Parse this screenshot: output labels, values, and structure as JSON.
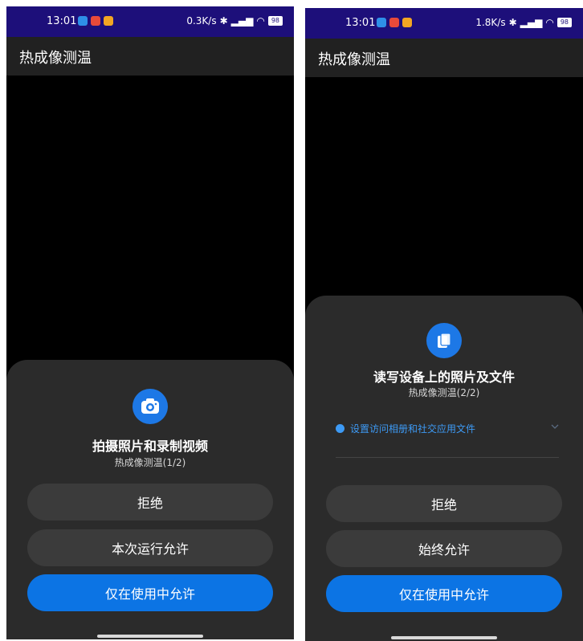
{
  "left": {
    "status": {
      "time": "13:01",
      "network": "0.3K/s",
      "battery": "98"
    },
    "app_title": "热成像测温",
    "dialog": {
      "icon": "camera-icon",
      "title": "拍摄照片和录制视频",
      "subtitle": "热成像测温(1/2)",
      "buttons": {
        "deny": "拒绝",
        "once": "本次运行允许",
        "while_using": "仅在使用中允许"
      }
    }
  },
  "right": {
    "status": {
      "time": "13:01",
      "network": "1.8K/s",
      "battery": "98"
    },
    "app_title": "热成像测温",
    "dialog": {
      "icon": "files-icon",
      "title": "读写设备上的照片及文件",
      "subtitle": "热成像测温(2/2)",
      "link": "设置访问相册和社交应用文件",
      "buttons": {
        "deny": "拒绝",
        "always": "始终允许",
        "while_using": "仅在使用中允许"
      }
    }
  },
  "colors": {
    "status_bar": "#1d0f7a",
    "app_bar": "#212121",
    "sheet": "#2b2b2b",
    "button": "#3b3b3b",
    "primary": "#0c74e4",
    "link": "#3d9af5"
  }
}
